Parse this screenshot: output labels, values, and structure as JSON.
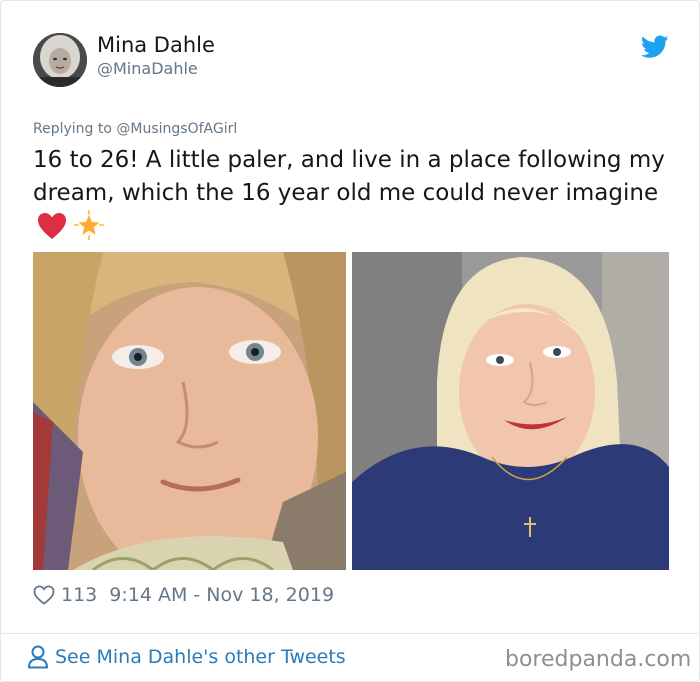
{
  "tweet": {
    "display_name": "Mina Dahle",
    "handle": "@MinaDahle",
    "reply_prefix": "Replying to",
    "reply_to": "@MusingsOfAGirl",
    "text": "16 to 26! A little paler, and live in a place following my dream, which  the 16 year old me could never imagine",
    "emojis": [
      "red-heart-icon",
      "glowing-star-icon"
    ],
    "likes": "113",
    "timestamp": "9:14 AM - Nov 18, 2019"
  },
  "footer": {
    "other_tweets_label": "See Mina Dahle's other Tweets",
    "watermark": "boredpanda.com"
  },
  "colors": {
    "link": "#2b7bb9",
    "twitter_blue": "#1da1f2",
    "muted": "#657786",
    "heart_red": "#e0245e"
  }
}
